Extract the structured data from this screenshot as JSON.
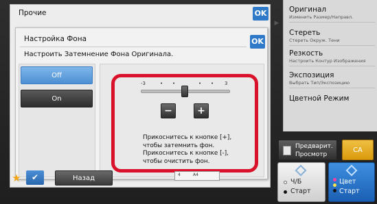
{
  "back_panel": {
    "title": "Прочие",
    "ok_label": "OK"
  },
  "dialog": {
    "title": "Настройка Фона",
    "ok_label": "OK",
    "subtitle": "Настроить Затемнение Фона Оригинала.",
    "off_label": "Off",
    "on_label": "On",
    "selected": "Off",
    "scale": {
      "min_label": "-3",
      "max_label": "3",
      "value": 0
    },
    "minus_label": "−",
    "plus_label": "+",
    "hint_lines": [
      "Прикоснитесь к кнопке [+],",
      "чтобы затемнить фон.",
      "Прикоснитесь к кнопке [-],",
      "чтобы очистить фон."
    ]
  },
  "right_panel": {
    "items": [
      {
        "title": "Оригинал",
        "sub": "Изменить Размер/Направл."
      },
      {
        "title": "Стереть",
        "sub": "Стереть Окруж. Тени"
      },
      {
        "title": "Резкость",
        "sub": "Настроить Контур Изображения"
      },
      {
        "title": "Экспозиция",
        "sub": "Выбрать Тип/Экспозицию"
      },
      {
        "title": "Цветной Режим",
        "sub": ""
      }
    ]
  },
  "bottom": {
    "back_label": "Назад",
    "mini_preview": {
      "left": "4",
      "mid": "A4"
    }
  },
  "actions": {
    "preview_line1": "Предварит.",
    "preview_line2": "Просмотр",
    "ca_label": "CA",
    "bw_label1": "Ч/Б",
    "bw_label2": "Старт",
    "color_label1": "Цвет",
    "color_label2": "Старт"
  },
  "colors": {
    "accent": "#2e7ac9",
    "highlight": "#d9112a",
    "ca": "#e2a91f",
    "start_color": "#2a72c8"
  }
}
